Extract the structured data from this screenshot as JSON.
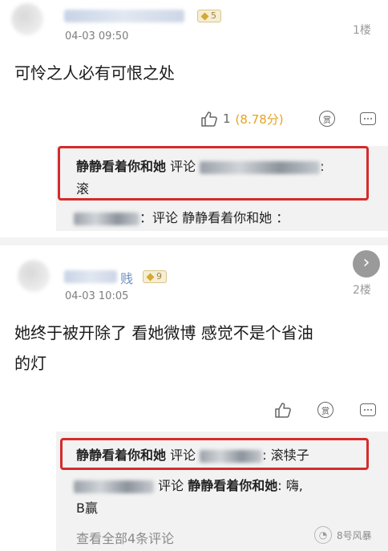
{
  "comments": [
    {
      "level": "5",
      "time": "04-03 09:50",
      "floor": "1楼",
      "text": "可怜之人必有可恨之处",
      "like_count": "1",
      "score": "(8.78分)",
      "reply_icon_label": "赏",
      "replies": [
        {
          "author": "静静看着你和她",
          "verb": "评论",
          "sep": ":",
          "text": "滚"
        },
        {
          "prefix": "：评论",
          "target": "静静看着你和她",
          "sep": "："
        }
      ]
    },
    {
      "name_suffix": "贱",
      "level": "9",
      "time": "04-03 10:05",
      "floor": "2楼",
      "text_line1": "她终于被开除了 看她微博 感觉不是个省油",
      "text_line2": "的灯",
      "reply_icon_label": "赏",
      "replies": [
        {
          "author": "静静看着你和她",
          "verb": "评论",
          "sep": ":",
          "text": "滚犊子"
        },
        {
          "verb": "评论",
          "target": "静静看着你和她",
          "sep": ":",
          "text1": "嗨,",
          "text2": "B赢"
        }
      ],
      "view_all": "查看全部4条评论"
    }
  ],
  "next_icon": "chevron-right-icon",
  "watermark": {
    "logo": "wechat-logo",
    "text": "8号风暴"
  },
  "colors": {
    "highlight": "#d52b2b",
    "reply_bg": "#f2f2f2",
    "level_badge": "#f6eed4"
  }
}
